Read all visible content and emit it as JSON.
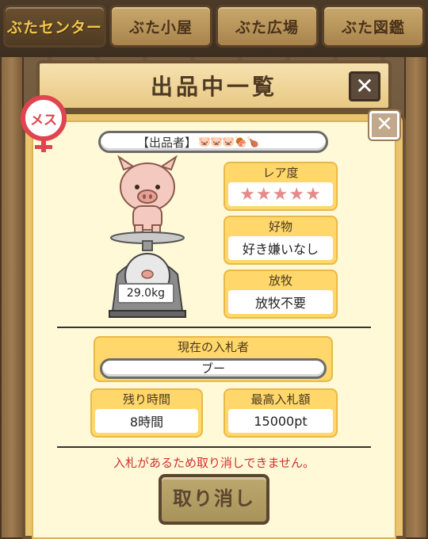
{
  "tabs": [
    {
      "label": "ぶたセンター",
      "active": true
    },
    {
      "label": "ぶた小屋",
      "active": false
    },
    {
      "label": "ぶた広場",
      "active": false
    },
    {
      "label": "ぶた図鑑",
      "active": false
    }
  ],
  "header": {
    "title": "出品中一覧",
    "close_glyph": "✕"
  },
  "panel": {
    "close_glyph": "✕"
  },
  "gender": {
    "label": "メス"
  },
  "seller": {
    "label": "【出品者】",
    "icons": "🐷🐷🐷🍖🍗"
  },
  "pig": {
    "weight": "29.0kg"
  },
  "rarity": {
    "label": "レア度",
    "stars": "★★★★★",
    "value": 5,
    "max": 5
  },
  "favorite": {
    "label": "好物",
    "value": "好き嫌いなし"
  },
  "grazing": {
    "label": "放牧",
    "value": "放牧不要"
  },
  "bidder": {
    "label": "現在の入札者",
    "value": "ブー"
  },
  "remaining": {
    "label": "残り時間",
    "value": "8時間"
  },
  "highest_bid": {
    "label": "最高入札額",
    "value": "15000pt"
  },
  "warning": "入札があるため取り消しできません。",
  "cancel_button": "取り消し",
  "colors": {
    "accent_red": "#d22f2f",
    "card_yellow": "#ffd76a",
    "star_pink": "#e58a8a"
  }
}
